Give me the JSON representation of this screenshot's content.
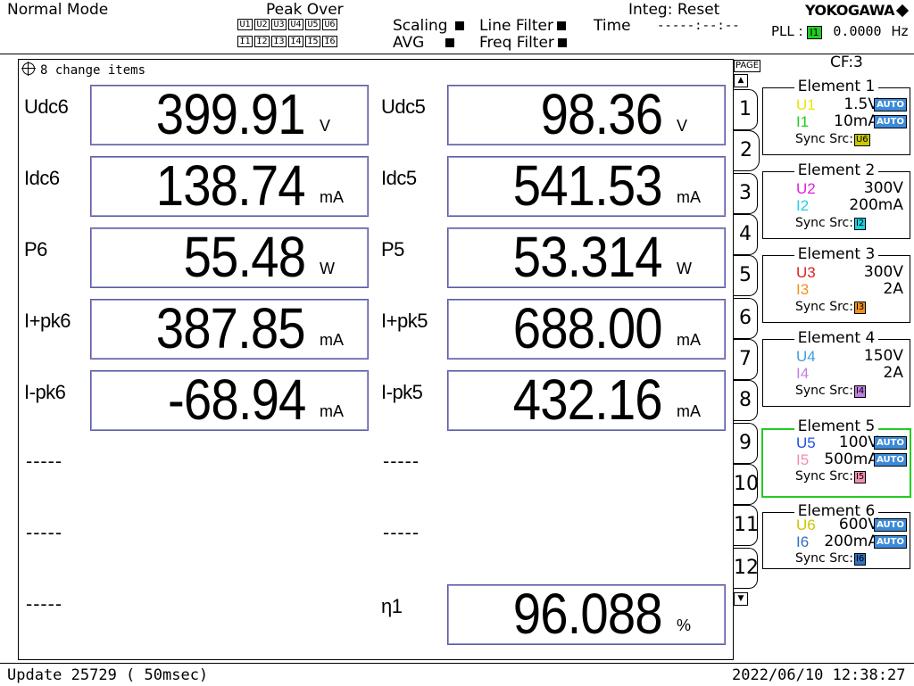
{
  "header": {
    "mode": "Normal Mode",
    "peak_over": "Peak Over",
    "peak_row1": [
      "U1",
      "U2",
      "U3",
      "U4",
      "U5",
      "U6"
    ],
    "peak_row2": [
      "I1",
      "I2",
      "I3",
      "I4",
      "I5",
      "I6"
    ],
    "scaling": "Scaling",
    "avg": "AVG",
    "line_filter": "Line Filter",
    "freq_filter": "Freq Filter",
    "time_label": "Time",
    "integ": "Integ: Reset",
    "integ_time": "-----:--:--",
    "brand": "YOKOGAWA",
    "pll_label": "PLL :",
    "pll_src": "I1",
    "pll_value": "0.0000",
    "pll_unit": "Hz"
  },
  "panel": {
    "title": "8 change items"
  },
  "measurements": {
    "left": [
      {
        "label": "Udc6",
        "value": "399.91",
        "unit": "V"
      },
      {
        "label": "Idc6",
        "value": "138.74",
        "unit": "mA"
      },
      {
        "label": "P6",
        "value": "55.48",
        "unit": "W"
      },
      {
        "label": "I+pk6",
        "value": "387.85",
        "unit": "mA"
      },
      {
        "label": "I-pk6",
        "value": "-68.94",
        "unit": "mA"
      },
      {
        "label": "-----"
      },
      {
        "label": "-----"
      },
      {
        "label": "-----"
      }
    ],
    "right": [
      {
        "label": "Udc5",
        "value": "98.36",
        "unit": "V"
      },
      {
        "label": "Idc5",
        "value": "541.53",
        "unit": "mA"
      },
      {
        "label": "P5",
        "value": "53.314",
        "unit": "W"
      },
      {
        "label": "I+pk5",
        "value": "688.00",
        "unit": "mA"
      },
      {
        "label": "I-pk5",
        "value": "432.16",
        "unit": "mA"
      },
      {
        "label": "-----"
      },
      {
        "label": "-----"
      },
      {
        "label": "η1",
        "value": "96.088",
        "unit": "%"
      }
    ]
  },
  "page_column": {
    "label": "PAGE",
    "pages": [
      "1",
      "2",
      "3",
      "4",
      "5",
      "6",
      "7",
      "8",
      "9",
      "10",
      "11",
      "12"
    ],
    "active_page": "2"
  },
  "cf": "CF:3",
  "elements": [
    {
      "title": "Element 1",
      "u_name": "U1",
      "u_range": "1.5V",
      "u_auto": "AUTO",
      "i_name": "I1",
      "i_range": "10mA",
      "i_auto": "AUTO",
      "sync_label": "Sync Src:",
      "sync_src": "U6",
      "u_color": "#e8e800",
      "i_color": "#22cc22",
      "sync_color": "#c8c800"
    },
    {
      "title": "Element 2",
      "u_name": "U2",
      "u_range": "300V",
      "i_name": "I2",
      "i_range": "200mA",
      "sync_label": "Sync Src:",
      "sync_src": "I2",
      "u_color": "#e020e0",
      "i_color": "#20d0e0",
      "sync_color": "#20d0e0"
    },
    {
      "title": "Element 3",
      "u_name": "U3",
      "u_range": "300V",
      "i_name": "I3",
      "i_range": "2A",
      "sync_label": "Sync Src:",
      "sync_src": "I3",
      "u_color": "#e02020",
      "i_color": "#f09020",
      "sync_color": "#f09020"
    },
    {
      "title": "Element 4",
      "u_name": "U4",
      "u_range": "150V",
      "i_name": "I4",
      "i_range": "2A",
      "sync_label": "Sync Src:",
      "sync_src": "I4",
      "u_color": "#40a0e0",
      "i_color": "#c080e0",
      "sync_color": "#c080e0"
    },
    {
      "title": "Element 5",
      "u_name": "U5",
      "u_range": "100V",
      "u_auto": "AUTO",
      "i_name": "I5",
      "i_range": "500mA",
      "i_auto": "AUTO",
      "sync_label": "Sync Src:",
      "sync_src": "I5",
      "u_color": "#2050e0",
      "i_color": "#f090b0",
      "sync_color": "#f090b0"
    },
    {
      "title": "Element 6",
      "u_name": "U6",
      "u_range": "600V",
      "u_auto": "AUTO",
      "i_name": "I6",
      "i_range": "200mA",
      "i_auto": "AUTO",
      "sync_label": "Sync Src:",
      "sync_src": "I6",
      "u_color": "#c8c800",
      "i_color": "#3070c0",
      "sync_color": "#3070c0"
    }
  ],
  "active_element": "Element 5",
  "colors": {
    "auto_badge": "#3c8ad8",
    "active_border": "#22cc22",
    "pll_badge": "#22cc22",
    "value_box_border": "#5a5aa0"
  },
  "footer": {
    "update": "Update 25729 ( 50msec)",
    "datetime": "2022/06/10 12:38:27"
  }
}
